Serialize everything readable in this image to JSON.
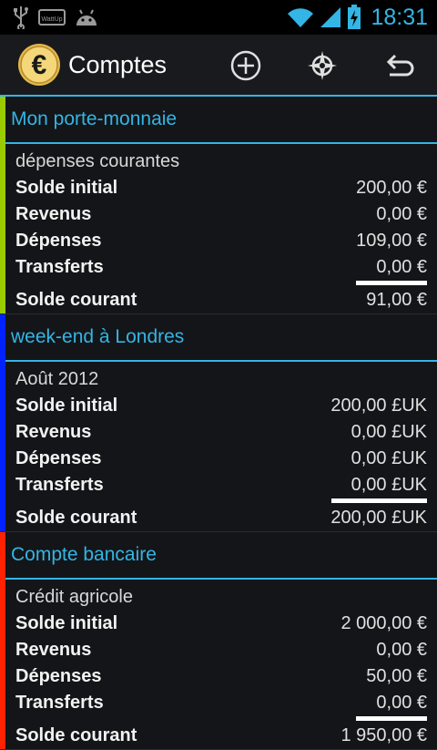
{
  "status_bar": {
    "time": "18:31",
    "icons": [
      "usb-icon",
      "wattup-icon",
      "android-icon",
      "wifi-icon",
      "signal-icon",
      "battery-charging-icon"
    ],
    "wattup_label": "WattUp"
  },
  "action_bar": {
    "title": "Comptes",
    "logo_symbol": "€",
    "actions": [
      "add-icon",
      "compass-icon",
      "back-icon"
    ]
  },
  "labels": {
    "initial": "Solde initial",
    "income": "Revenus",
    "expenses": "Dépenses",
    "transfers": "Transferts",
    "current": "Solde courant"
  },
  "accounts": [
    {
      "name": "Mon porte-monnaie",
      "description": "dépenses courantes",
      "color": "#99cc00",
      "initial": "200,00 €",
      "income": "0,00 €",
      "expenses": "109,00 €",
      "transfers": "0,00 €",
      "current": "91,00 €"
    },
    {
      "name": "week-end à Londres",
      "description": "Août 2012",
      "color": "#0022ff",
      "initial": "200,00 £UK",
      "income": "0,00 £UK",
      "expenses": "0,00 £UK",
      "transfers": "0,00 £UK",
      "current": "200,00 £UK"
    },
    {
      "name": "Compte bancaire",
      "description": "Crédit agricole",
      "color": "#ff2200",
      "initial": "2 000,00 €",
      "income": "0,00 €",
      "expenses": "50,00 €",
      "transfers": "0,00 €",
      "current": "1 950,00 €"
    }
  ]
}
